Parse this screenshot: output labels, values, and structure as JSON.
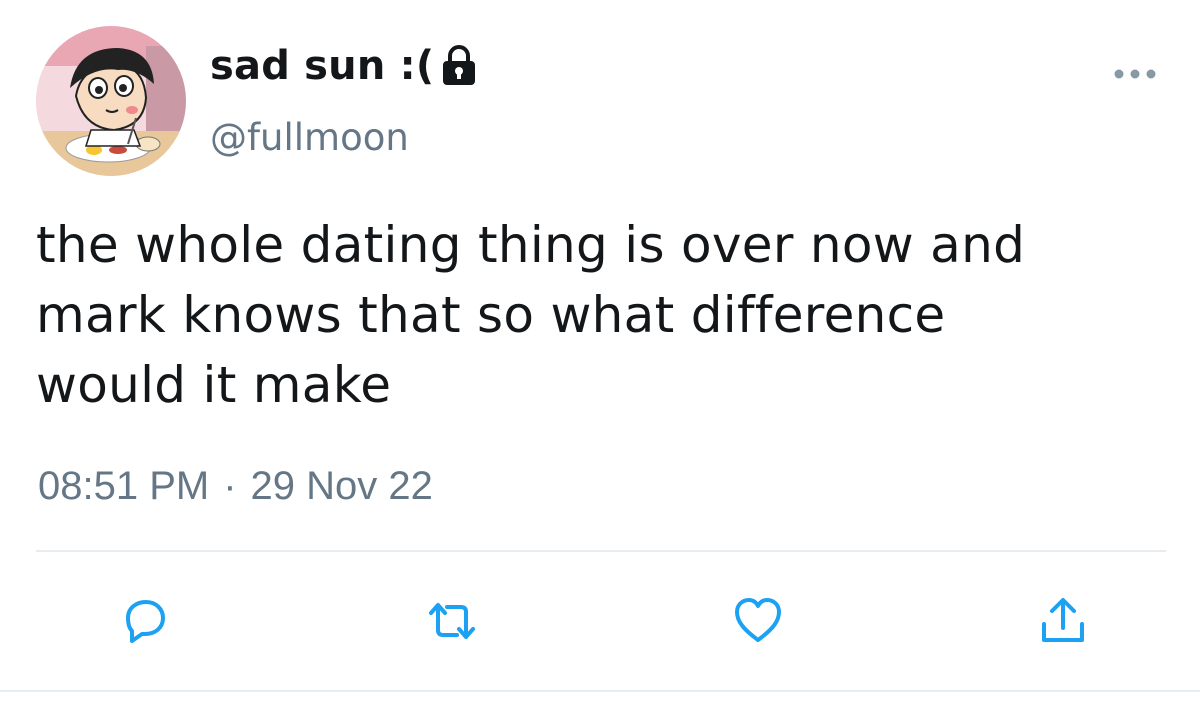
{
  "user": {
    "display_name": "sad sun :(",
    "handle": "@fullmoon",
    "avatar_icon": "cartoon-avatar",
    "protected_icon": "lock-icon"
  },
  "tweet": {
    "text": "the whole dating thing is over now and\nmark knows that so what difference\nwould it make",
    "time": "08:51 PM",
    "separator": "·",
    "date": "29 Nov 22"
  },
  "actions": {
    "more": "more-icon",
    "reply": "reply-icon",
    "retweet": "retweet-icon",
    "like": "heart-icon",
    "share": "share-icon"
  },
  "colors": {
    "text": "#14171a",
    "secondary": "#657786",
    "icon": "#1da1f2",
    "divider": "#e6ecf0"
  }
}
